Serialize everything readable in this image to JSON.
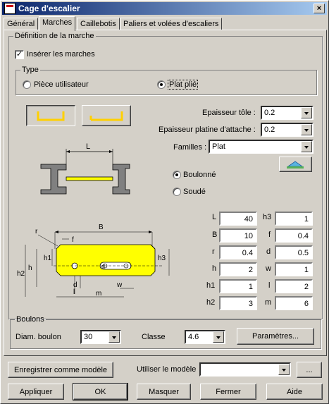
{
  "window": {
    "title": "Cage d'escalier",
    "close_glyph": "×"
  },
  "tabs": [
    "Général",
    "Marches",
    "Caillebotis",
    "Paliers et volées d'escaliers"
  ],
  "marche": {
    "group_title": "Définition de la marche",
    "insert_label": "Insérer les marches",
    "insert_checked": true,
    "type_group": "Type",
    "type_options": [
      "Pièce utilisateur",
      "Plat plié"
    ],
    "type_selected": "Plat plié"
  },
  "props": {
    "epaisseur_tole_label": "Epaisseur tôle :",
    "epaisseur_tole_value": "0.2",
    "epaisseur_platine_label": "Epaisseur platine d'attache :",
    "epaisseur_platine_value": "0.2",
    "familles_label": "Familles :",
    "familles_value": "Plat"
  },
  "assembly": {
    "options": [
      "Boulonné",
      "Soudé"
    ],
    "selected": "Boulonné"
  },
  "diagram_labels": {
    "L": "L",
    "B": "B",
    "r": "r",
    "f": "f",
    "h1": "h1",
    "h2": "h2",
    "h3": "h3",
    "h": "h",
    "d": "d",
    "l": "l",
    "m": "m",
    "w": "w"
  },
  "dimensions": {
    "left": [
      {
        "label": "L",
        "value": "40"
      },
      {
        "label": "B",
        "value": "10"
      },
      {
        "label": "r",
        "value": "0.4"
      },
      {
        "label": "h",
        "value": "2"
      },
      {
        "label": "h1",
        "value": "1"
      },
      {
        "label": "h2",
        "value": "3"
      }
    ],
    "right": [
      {
        "label": "h3",
        "value": "1"
      },
      {
        "label": "f",
        "value": "0.4"
      },
      {
        "label": "d",
        "value": "0.5"
      },
      {
        "label": "w",
        "value": "1"
      },
      {
        "label": "l",
        "value": "2"
      },
      {
        "label": "m",
        "value": "6"
      }
    ]
  },
  "boulons": {
    "group_title": "Boulons",
    "diam_label": "Diam. boulon",
    "diam_value": "30",
    "classe_label": "Classe",
    "classe_value": "4.6",
    "params_button": "Paramètres..."
  },
  "model": {
    "save_button": "Enregistrer comme modèle",
    "use_label": "Utiliser le modèle",
    "use_value": "",
    "browse_button": "..."
  },
  "footer": {
    "apply": "Appliquer",
    "ok": "OK",
    "hide": "Masquer",
    "close": "Fermer",
    "help": "Aide"
  },
  "colors": {
    "plate_fill": "#ffff00",
    "profile_fill": "#808080",
    "titlebar": "#0a246a"
  }
}
